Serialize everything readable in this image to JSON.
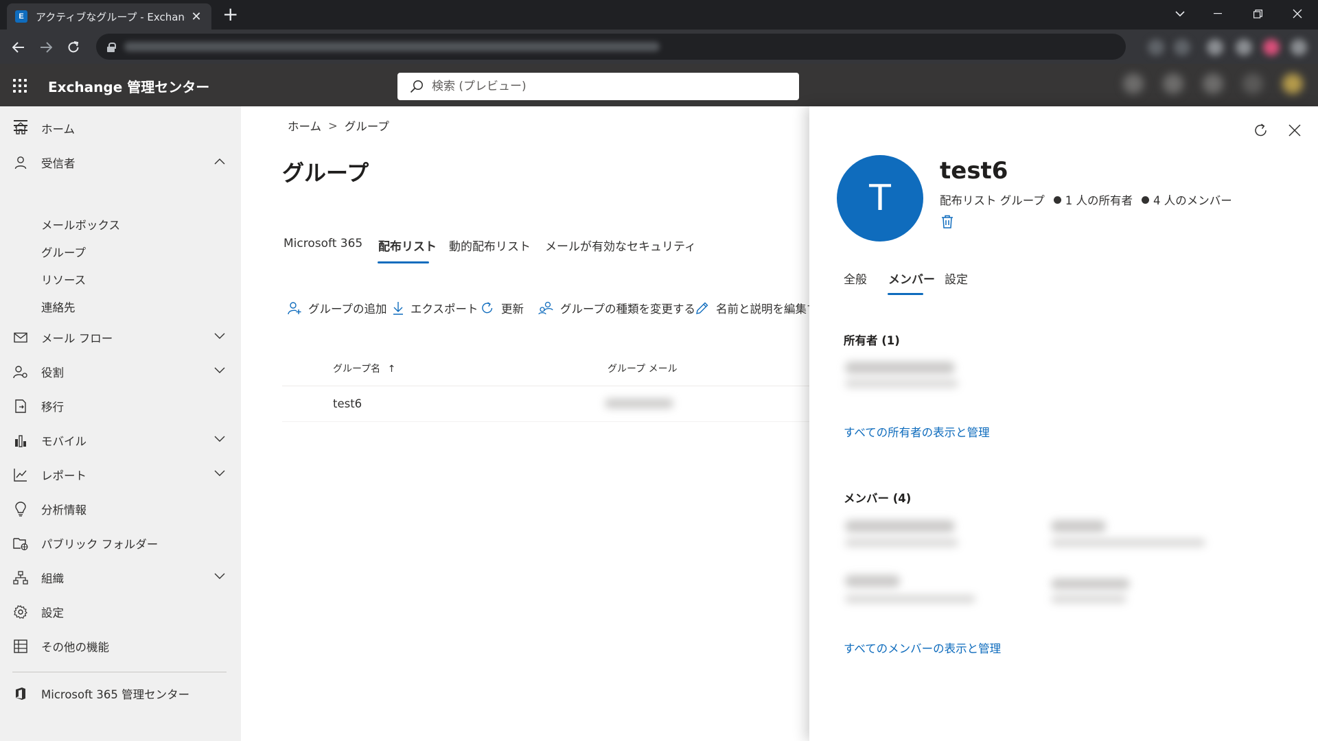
{
  "browser": {
    "tab_title": "アクティブなグループ - Exchange admin center",
    "favicon_text": "E",
    "new_tab_symbol": "+"
  },
  "app": {
    "name": "Exchange 管理センター",
    "search_placeholder": "検索 (プレビュー)"
  },
  "leftnav": {
    "items": [
      {
        "label": "ホーム",
        "icon": "home-icon"
      },
      {
        "label": "受信者",
        "icon": "person-icon",
        "expanded": true
      },
      {
        "label": "メール フロー",
        "icon": "mail-icon"
      },
      {
        "label": "役割",
        "icon": "role-icon"
      },
      {
        "label": "移行",
        "icon": "migration-icon"
      },
      {
        "label": "モバイル",
        "icon": "mobile-icon"
      },
      {
        "label": "レポート",
        "icon": "report-icon"
      },
      {
        "label": "分析情報",
        "icon": "lightbulb-icon"
      },
      {
        "label": "パブリック フォルダー",
        "icon": "public-folder-icon"
      },
      {
        "label": "組織",
        "icon": "organization-icon"
      },
      {
        "label": "設定",
        "icon": "gear-icon"
      },
      {
        "label": "その他の機能",
        "icon": "table-icon"
      }
    ],
    "recipients_sub": [
      "メールボックス",
      "グループ",
      "リソース",
      "連絡先"
    ],
    "footer_link": "Microsoft 365 管理センター"
  },
  "main": {
    "breadcrumb": [
      "ホーム",
      "グループ"
    ],
    "breadcrumb_sep": ">",
    "title": "グループ",
    "tabs": [
      "Microsoft 365",
      "配布リスト",
      "動的配布リスト",
      "メールが有効なセキュリティ"
    ],
    "active_tab": "配布リスト",
    "commands": [
      "グループの追加",
      "エクスポート",
      "更新",
      "グループの種類を変更する",
      "名前と説明を編集す"
    ],
    "columns": [
      "グループ名",
      "グループ メール"
    ],
    "sort_indicator": "↑",
    "rows": [
      {
        "name": "test6"
      }
    ]
  },
  "panel": {
    "avatar_letter": "T",
    "group_name": "test6",
    "group_type": "配布リスト グループ",
    "owners_count": "1 人の所有者",
    "members_count": "4 人のメンバー",
    "tabs": [
      "全般",
      "メンバー",
      "設定"
    ],
    "active_tab": "メンバー",
    "owners_header": "所有者 (1)",
    "owners_link": "すべての所有者の表示と管理",
    "members_header": "メンバー (4)",
    "members_link": "すべてのメンバーの表示と管理"
  },
  "colors": {
    "accent": "#0f6cbd",
    "header_bg": "#373636",
    "nav_bg": "#f0f0f0"
  }
}
